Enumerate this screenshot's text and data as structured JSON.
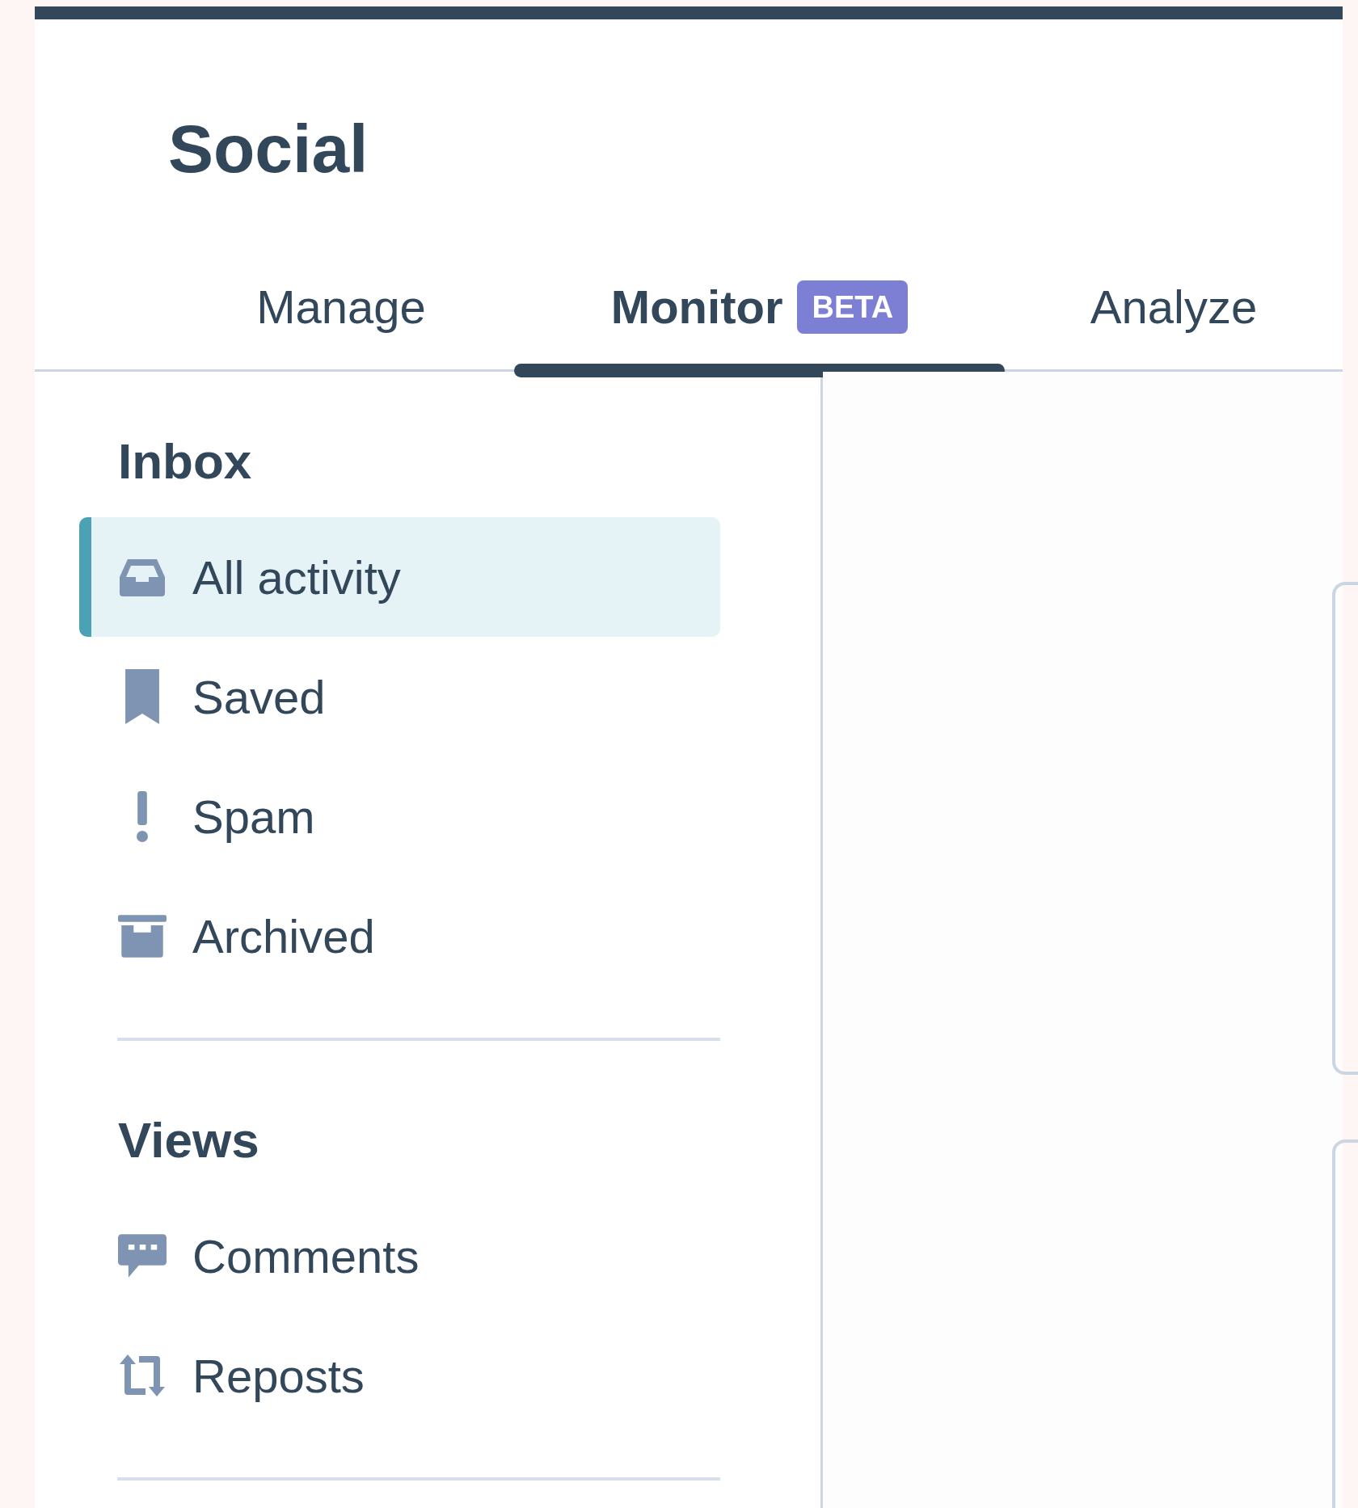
{
  "app": {
    "title": "Social"
  },
  "tabs": [
    {
      "label": "Manage",
      "selected": false
    },
    {
      "label": "Monitor",
      "selected": true,
      "badge": "BETA"
    },
    {
      "label": "Analyze",
      "selected": false
    }
  ],
  "sidebar": {
    "sections": [
      {
        "heading": "Inbox",
        "items": [
          {
            "label": "All activity",
            "selected": true
          },
          {
            "label": "Saved",
            "selected": false
          },
          {
            "label": "Spam",
            "selected": false
          },
          {
            "label": "Archived",
            "selected": false
          }
        ]
      },
      {
        "heading": "Views",
        "items": [
          {
            "label": "Comments",
            "selected": false
          },
          {
            "label": "Reposts",
            "selected": false
          }
        ]
      }
    ]
  }
}
